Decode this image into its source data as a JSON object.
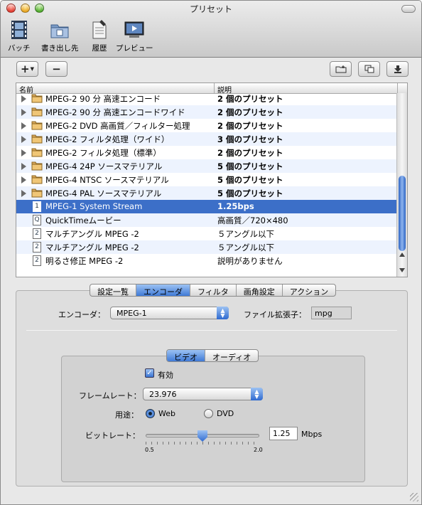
{
  "window": {
    "title": "プリセット"
  },
  "toolbar": [
    {
      "id": "batch",
      "label": "バッチ",
      "icon": "filmstrip-icon"
    },
    {
      "id": "destinations",
      "label": "書き出し先",
      "icon": "folder-icon"
    },
    {
      "id": "history",
      "label": "履歴",
      "icon": "document-list-icon"
    },
    {
      "id": "preview",
      "label": "プレビュー",
      "icon": "monitor-icon"
    }
  ],
  "list_buttons": {
    "add": "+",
    "remove": "−",
    "add_folder": "folder-plus-icon",
    "duplicate": "duplicate-icon",
    "export": "export-icon"
  },
  "list": {
    "columns": [
      "名前",
      "説明"
    ],
    "rows": [
      {
        "name": "MPEG-2 90 分 高速エンコード",
        "desc": "2 個のプリセット",
        "kind": "folder"
      },
      {
        "name": "MPEG-2 90 分 高速エンコードワイド",
        "desc": "2 個のプリセット",
        "kind": "folder"
      },
      {
        "name": "MPEG-2 DVD 高画質／フィルター処理",
        "desc": "2 個のプリセット",
        "kind": "folder"
      },
      {
        "name": "MPEG-2 フィルタ処理（ワイド）",
        "desc": "3 個のプリセット",
        "kind": "folder"
      },
      {
        "name": "MPEG-2 フィルタ処理（標準）",
        "desc": "2 個のプリセット",
        "kind": "folder"
      },
      {
        "name": "MPEG-4 24P ソースマテリアル",
        "desc": "5 個のプリセット",
        "kind": "folder"
      },
      {
        "name": "MPEG-4 NTSC ソースマテリアル",
        "desc": "5 個のプリセット",
        "kind": "folder"
      },
      {
        "name": "MPEG-4 PAL ソースマテリアル",
        "desc": "5 個のプリセット",
        "kind": "folder"
      },
      {
        "name": "MPEG-1 System Stream",
        "desc": "1.25bps",
        "kind": "doc",
        "badge": "1",
        "selected": true
      },
      {
        "name": "QuickTimeムービー",
        "desc": "高画質／720×480",
        "kind": "doc",
        "badge": "Q"
      },
      {
        "name": "マルチアングル MPEG -2",
        "desc": "５アングル以下",
        "kind": "doc",
        "badge": "2"
      },
      {
        "name": "マルチアングル MPEG -2",
        "desc": "５アングル以下",
        "kind": "doc",
        "badge": "2"
      },
      {
        "name": "明るさ修正 MPEG -2",
        "desc": "説明がありません",
        "kind": "doc",
        "badge": "2"
      }
    ]
  },
  "tabs": [
    "設定一覧",
    "エンコーダ",
    "フィルタ",
    "画角設定",
    "アクション"
  ],
  "active_tab": "エンコーダ",
  "encoder": {
    "label": "エンコーダ：",
    "value": "MPEG-1",
    "ext_label": "ファイル拡張子：",
    "ext_value": "mpg"
  },
  "subtabs": [
    "ビデオ",
    "オーディオ"
  ],
  "active_subtab": "ビデオ",
  "video": {
    "enabled_label": "有効",
    "enabled": true,
    "framerate_label": "フレームレート：",
    "framerate_value": "23.976",
    "usage_label": "用途：",
    "usage_options": [
      "Web",
      "DVD"
    ],
    "usage_selected": "Web",
    "bitrate_label": "ビットレート：",
    "bitrate_value": "1.25",
    "bitrate_unit": "Mbps",
    "bitrate_min": "0.5",
    "bitrate_max": "2.0",
    "bitrate_level": 1.25
  },
  "colors": {
    "selection": "#3c6fc8",
    "accent": "#2f6ad0",
    "alt_row": "#edf3fe"
  }
}
